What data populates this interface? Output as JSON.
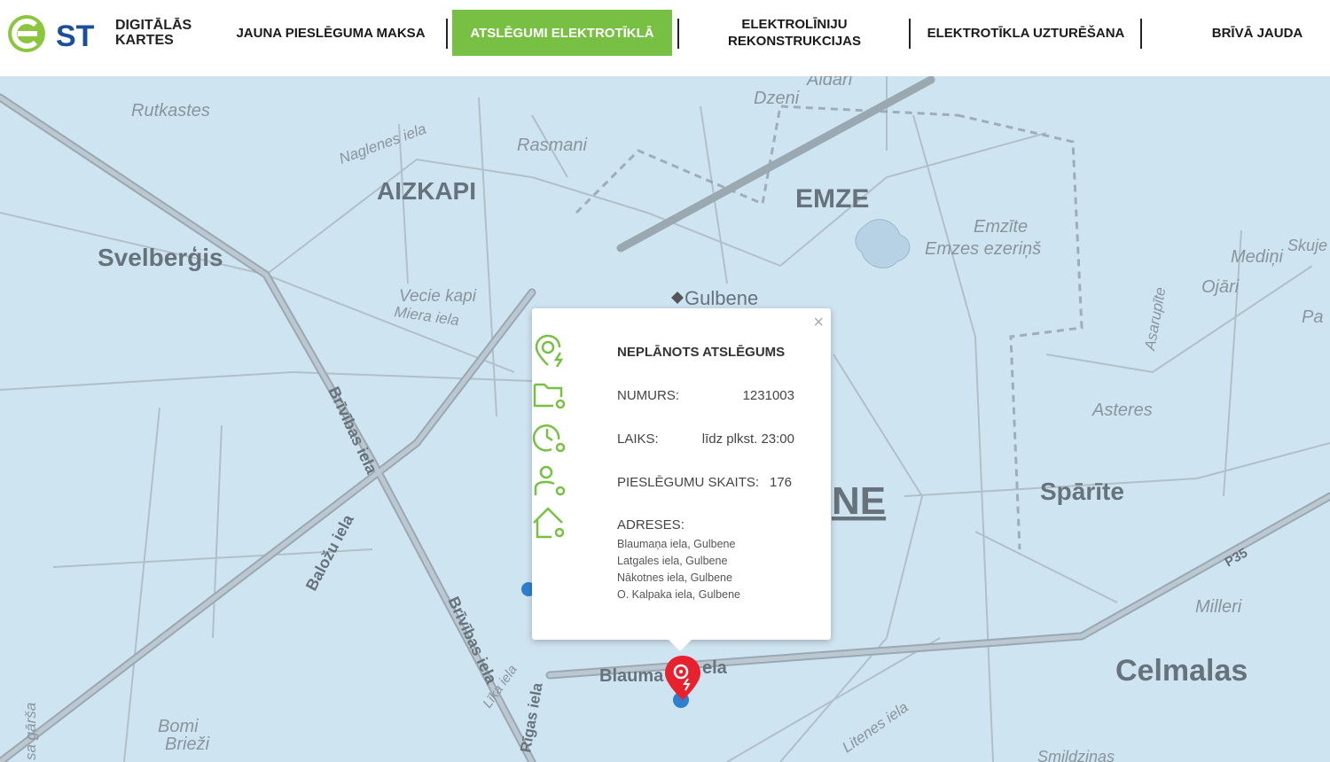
{
  "logo": {
    "mark": "ST",
    "line1": "DIGITĀLĀS",
    "line2": "KARTES"
  },
  "nav": [
    {
      "label": "JAUNA PIESLĒGUMA MAKSA"
    },
    {
      "label": "ATSLĒGUMI ELEKTROTĪKLĀ",
      "active": true
    },
    {
      "label1": "ELEKTROLĪNIJU",
      "label2": "REKONSTRUKCIJAS"
    },
    {
      "label": "ELEKTROTĪKLA UZTURĒŠANA"
    },
    {
      "label": "BRĪVĀ JAUDA"
    }
  ],
  "colors": {
    "accent": "#78c043",
    "marker": "#e8212e",
    "map_bg": "#cfe4f1",
    "road": "#9aa8b2"
  },
  "map_labels": {
    "rutkastes": "Rutkastes",
    "naglenes": "Naglenes iela",
    "aizkapi": "AIZKAPI",
    "rasmani": "Rasmani",
    "aidari": "Aidari",
    "drzeni": "Dzeni",
    "emze": "EMZE",
    "emzite": "Emzīte",
    "emzes_ezerins": "Emzes ezeriņš",
    "medini": "Mediņi",
    "skuje": "Skuje",
    "ojari": "Ojāri",
    "pa": "Pa",
    "asarupite": "Asarupīte",
    "svelbergis": "Svelberģis",
    "vecie_kapi": "Vecie kapi",
    "miera": "Miera iela",
    "gulbene": "Gulbene",
    "brivibas1": "Brīvības iela",
    "brivibas2": "Brīvības iela",
    "balozu": "Baložu iela",
    "asteres": "Asteres",
    "spārīte": "Spārīte",
    "ne": "NE",
    "p35": "P35",
    "milleri": "Milleri",
    "celmalas": "Celmalas",
    "blauma": "Blauma",
    "ela": "ela",
    "lika": "Līka iela",
    "rigas": "Rīgas iela",
    "litenes": "Litenes iela",
    "bomi": "Bomi",
    "briezi": "Brieži",
    "garsa": "sa gārša",
    "smildzinas": "Smildzinas"
  },
  "popup": {
    "title": "NEPLĀNOTS ATSLĒGUMS",
    "numurs_label": "NUMURS:",
    "numurs_value": "1231003",
    "laiks_label": "LAIKS:",
    "laiks_value": "līdz plkst. 23:00",
    "skaits_label": "PIESLĒGUMU SKAITS:",
    "skaits_value": "176",
    "adreses_label": "ADRESES:",
    "addresses": [
      "Blaumaņa iela, Gulbene",
      "Latgales iela, Gulbene",
      "Nākotnes iela, Gulbene",
      "O. Kalpaka iela, Gulbene"
    ],
    "close": "×"
  }
}
